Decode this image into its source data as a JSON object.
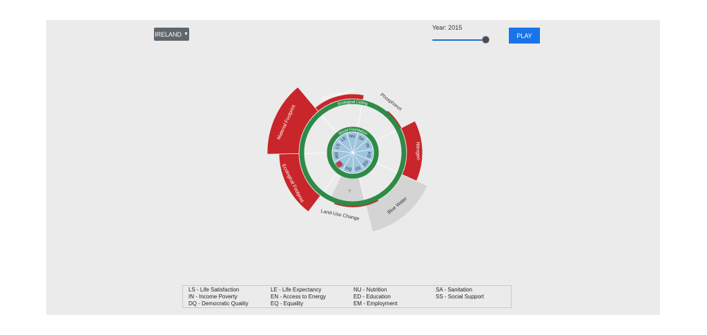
{
  "controls": {
    "country": "IRELAND",
    "year_label": "Year: 2015",
    "year_progress": 0.93,
    "play_label": "PLAY"
  },
  "rings": {
    "ecological_ceiling": "Ecological Ceiling",
    "social_foundation": "Social Foundation"
  },
  "ecological_segments": [
    {
      "label": "CO2 Emissions",
      "status": "overshoot"
    },
    {
      "label": "Phosphorus",
      "status": "within"
    },
    {
      "label": "Nitrogen",
      "status": "overshoot"
    },
    {
      "label": "Blue Water",
      "status": "unknown"
    },
    {
      "label": "Land-Use Change",
      "status": "within"
    },
    {
      "label": "Ecological Footprint",
      "status": "overshoot"
    },
    {
      "label": "Material Footprint",
      "status": "overshoot"
    }
  ],
  "social_segments": [
    "NU",
    "SA",
    "IN",
    "EN",
    "ED",
    "SS",
    "DQ",
    "EQ",
    "EM",
    "LS",
    "LE"
  ],
  "unknown_marker": "?",
  "colors": {
    "overshoot": "#c8262a",
    "within": "#9ccc8c",
    "ring": "#2e8b47",
    "unknown": "#d4d4d4",
    "social": "#9ec4de",
    "play": "#1a73e8"
  },
  "legend": [
    [
      "LS - Life Satisfaction",
      "LE - Life Expectancy",
      "NU - Nutrition",
      "SA - Sanitation"
    ],
    [
      "IN - Income Poverty",
      "EN - Access to Energy",
      "ED - Education",
      "SS - Social Support"
    ],
    [
      "DQ - Democratic Quality",
      "EQ - Equality",
      "EM - Employment"
    ]
  ]
}
